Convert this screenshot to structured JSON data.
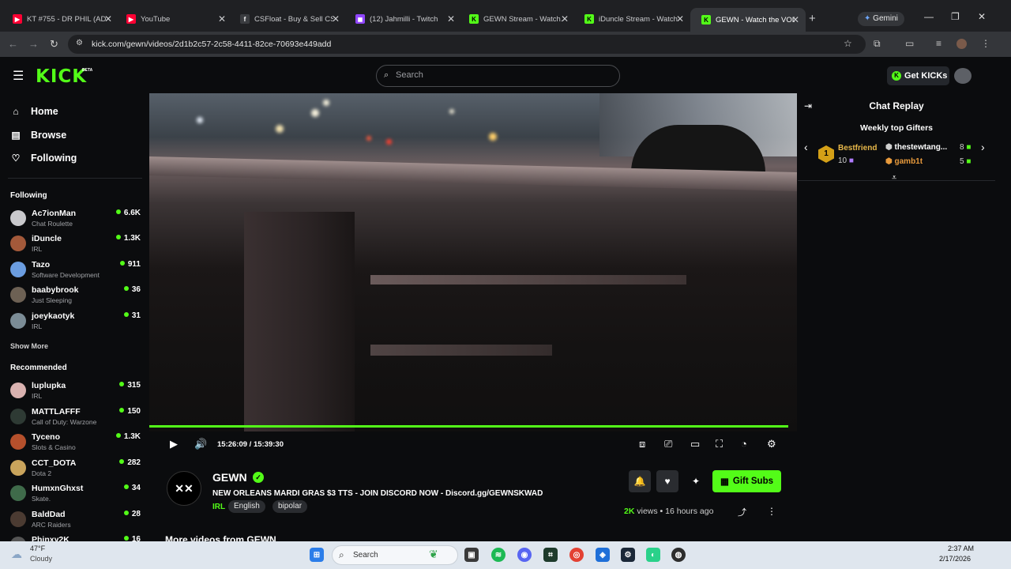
{
  "browser": {
    "tabs": [
      {
        "title": "KT #755 - DR PHIL (AD...",
        "icon": "youtube-icon",
        "color": "#ff0033"
      },
      {
        "title": "YouTube",
        "icon": "youtube-icon",
        "color": "#ff0033"
      },
      {
        "title": "CSFloat - Buy & Sell CS...",
        "icon": "csfloat-icon",
        "color": "#3a3c40"
      },
      {
        "title": "(12) Jahmilli - Twitch",
        "icon": "twitch-icon",
        "color": "#9146ff"
      },
      {
        "title": "GEWN Stream - Watch...",
        "icon": "kick-icon",
        "color": "#53fc18"
      },
      {
        "title": "iDuncle Stream - Watch...",
        "icon": "kick-icon",
        "color": "#53fc18"
      },
      {
        "title": "GEWN - Watch the VOD",
        "icon": "kick-icon",
        "color": "#53fc18"
      }
    ],
    "gemini_label": "Gemini",
    "url": "kick.com/gewn/videos/2d1b2c57-2c58-4411-82ce-70693e449add"
  },
  "header": {
    "logo": "KICK",
    "logo_badge": "BETA",
    "search_placeholder": "Search",
    "get_kicks": "Get KICKs"
  },
  "sidebar": {
    "nav": [
      {
        "label": "Home",
        "icon": "home-icon"
      },
      {
        "label": "Browse",
        "icon": "browse-icon"
      },
      {
        "label": "Following",
        "icon": "heart-icon"
      }
    ],
    "following_title": "Following",
    "following": [
      {
        "name": "Ac7ionMan",
        "category": "Chat Roulette",
        "viewers": "6.6K",
        "color": "#c9c9cc"
      },
      {
        "name": "iDuncle",
        "category": "IRL",
        "viewers": "1.3K",
        "color": "#a3593a"
      },
      {
        "name": "Tazo",
        "category": "Software Development",
        "viewers": "911",
        "color": "#6b9de0"
      },
      {
        "name": "baabybrook",
        "category": "Just Sleeping",
        "viewers": "36",
        "color": "#6d6154"
      },
      {
        "name": "joeykaotyk",
        "category": "IRL",
        "viewers": "31",
        "color": "#7b8c96"
      }
    ],
    "show_more": "Show More",
    "recommended_title": "Recommended",
    "recommended": [
      {
        "name": "luplupka",
        "category": "IRL",
        "viewers": "315",
        "color": "#d9b2b0"
      },
      {
        "name": "MATTLAFFF",
        "category": "Call of Duty: Warzone",
        "viewers": "150",
        "color": "#2e3a34"
      },
      {
        "name": "Tyceno",
        "category": "Slots & Casino",
        "viewers": "1.3K",
        "color": "#b5502c"
      },
      {
        "name": "CCT_DOTA",
        "category": "Dota 2",
        "viewers": "282",
        "color": "#c9a45c"
      },
      {
        "name": "HumxnGhxst",
        "category": "Skate.",
        "viewers": "34",
        "color": "#3f6b4a"
      },
      {
        "name": "BaldDad",
        "category": "ARC Raiders",
        "viewers": "28",
        "color": "#4b3b32"
      },
      {
        "name": "Phinxy2K",
        "category": "",
        "viewers": "16",
        "color": "#555"
      }
    ]
  },
  "player": {
    "time_current": "15:26:09",
    "time_sep": "/",
    "time_total": "15:39:30",
    "progress": 0.986
  },
  "channel": {
    "avatar_text": "✕✕",
    "name": "GEWN",
    "title": "NEW ORLEANS MARDI GRAS $3 TTS - JOIN DISCORD NOW - Discord.gg/GEWNSKWAD",
    "category": "IRL",
    "tags": [
      "English",
      "bipolar"
    ],
    "gift_subs": "Gift Subs",
    "views_count": "2K",
    "views_label": "views",
    "dot": "•",
    "age": "16 hours ago",
    "more_videos": "More videos from GEWN"
  },
  "chat": {
    "title": "Chat Replay",
    "gifters_title": "Weekly top Gifters",
    "top_gifter": {
      "rank": "1",
      "name": "Bestfriend",
      "count": "10"
    },
    "gifters": [
      {
        "name": "thestewtang...",
        "count": "8"
      },
      {
        "name": "gamb1t",
        "count": "5"
      }
    ]
  },
  "taskbar": {
    "weather_temp": "47°F",
    "weather_desc": "Cloudy",
    "search_placeholder": "Search",
    "time": "2:37 AM",
    "date": "2/17/2026"
  }
}
